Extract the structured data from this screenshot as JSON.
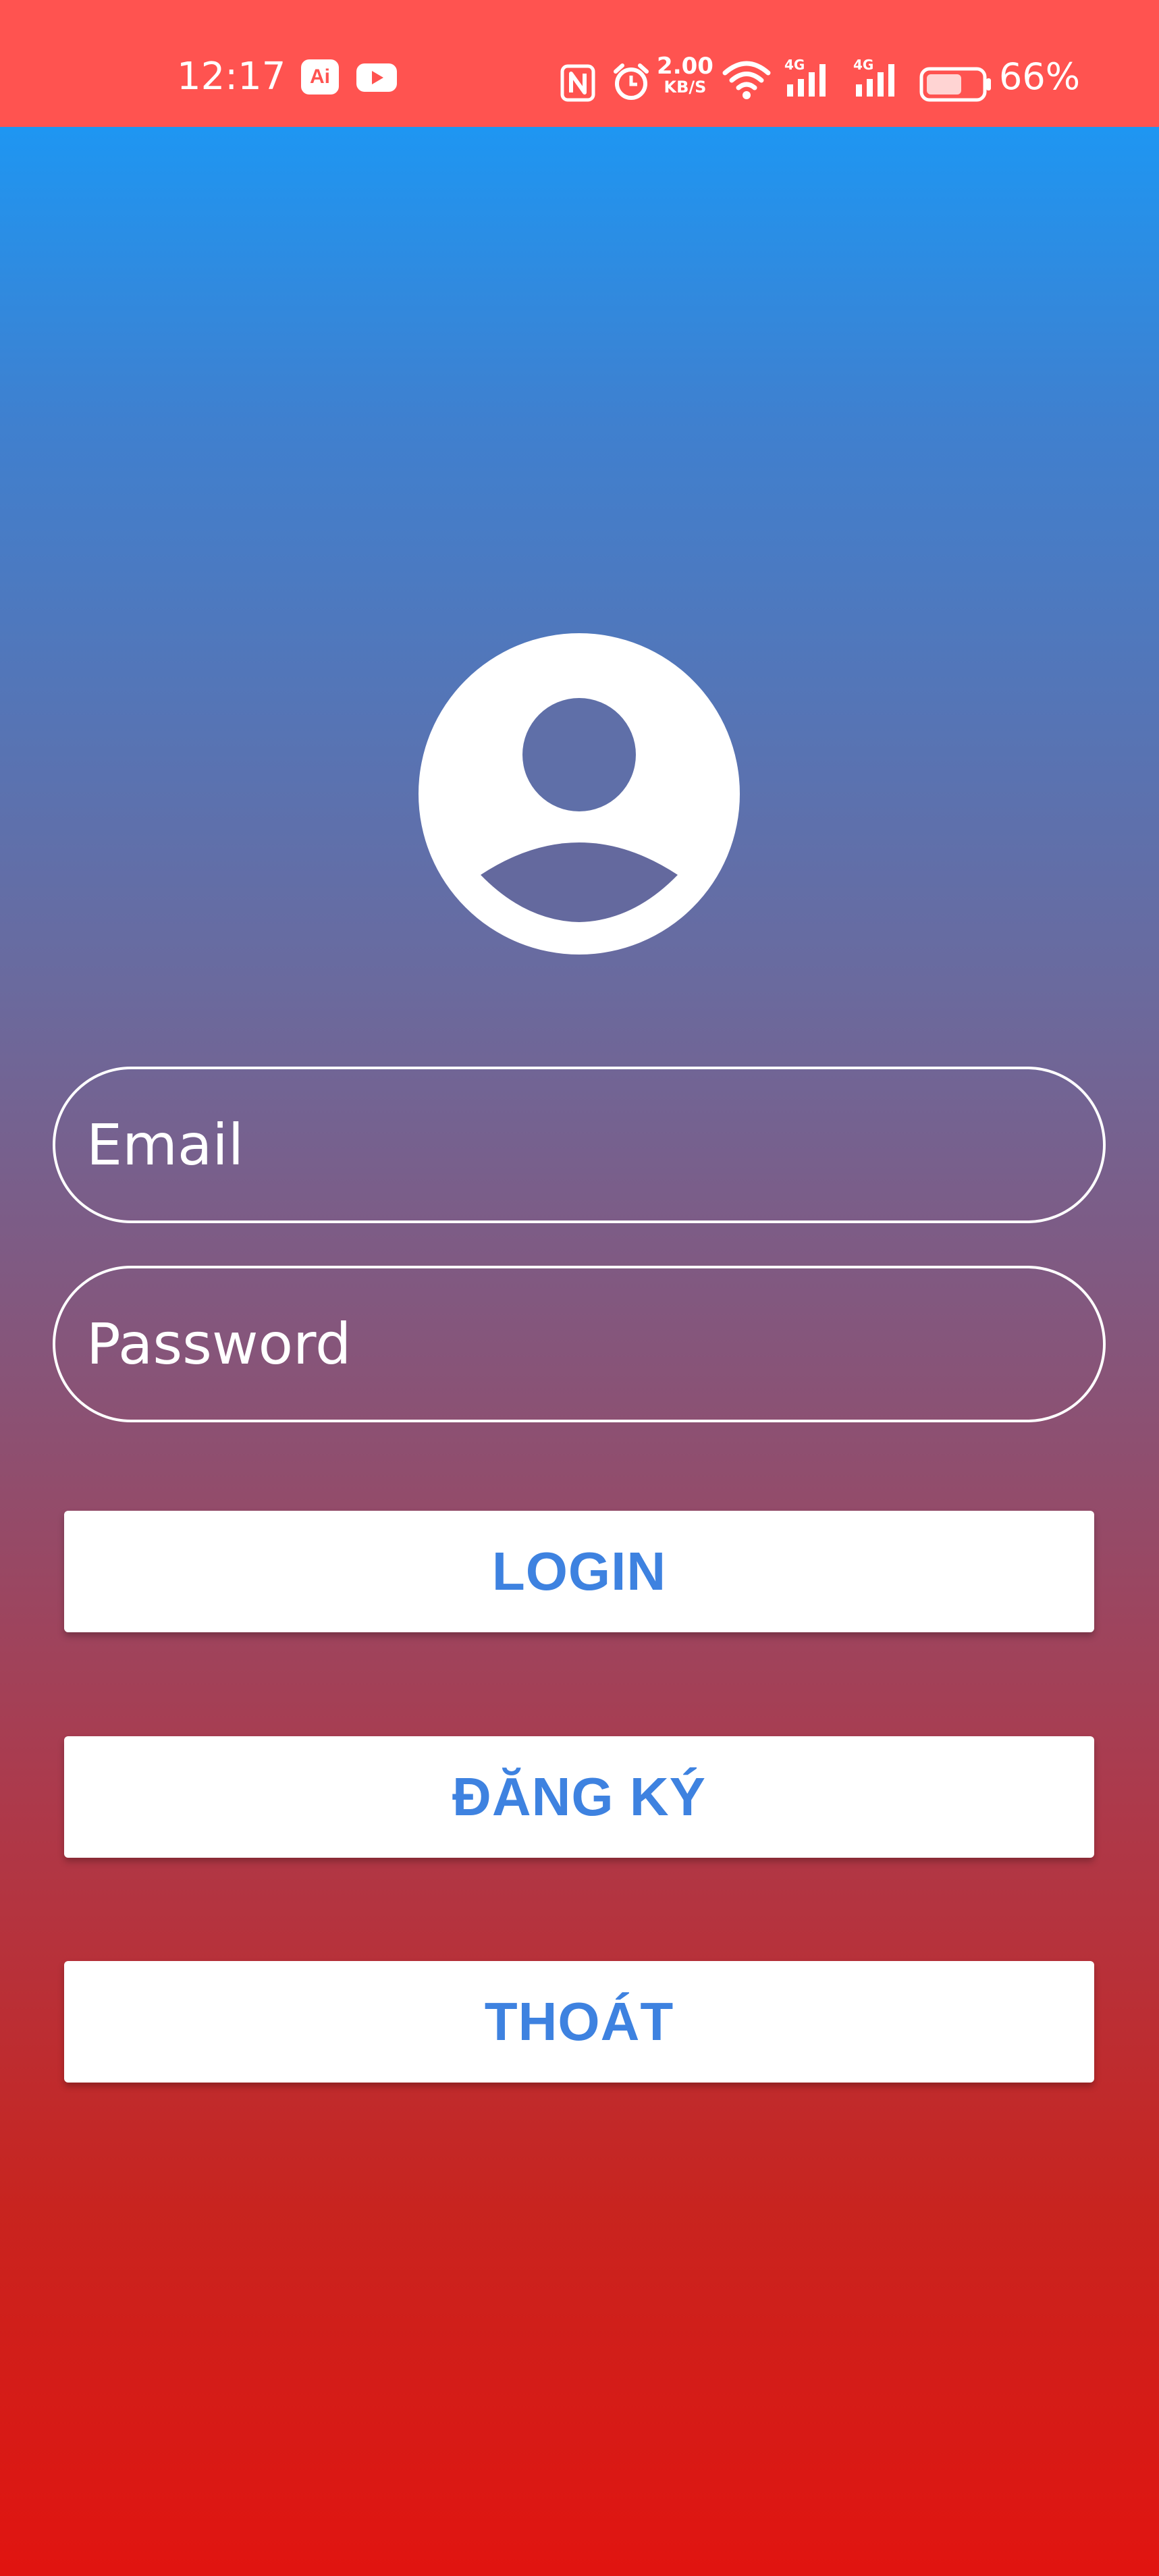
{
  "status_bar": {
    "time": "12:17",
    "ai_app_label": "Ai",
    "net_speed_value": "2.00",
    "net_speed_unit": "KB/S",
    "network_1": "4G",
    "network_2": "4G",
    "battery": "66%",
    "battery_level": 0.66
  },
  "icons": {
    "avatar": "account-circle-icon",
    "nfc": "nfc-icon",
    "alarm": "alarm-icon",
    "wifi": "wifi-icon",
    "signal": "cell-signal-icon",
    "battery": "battery-icon",
    "youtube": "youtube-icon"
  },
  "login_form": {
    "email_placeholder": "Email",
    "email_value": "",
    "password_placeholder": "Password",
    "password_value": ""
  },
  "buttons": {
    "login": "LOGIN",
    "register": "ĐĂNG KÝ",
    "exit": "THOÁT"
  },
  "colors": {
    "status_bar": "#FF5350",
    "gradient_top": "#1E96F2",
    "gradient_bottom": "#E11410",
    "button_text": "#3E82E0"
  }
}
